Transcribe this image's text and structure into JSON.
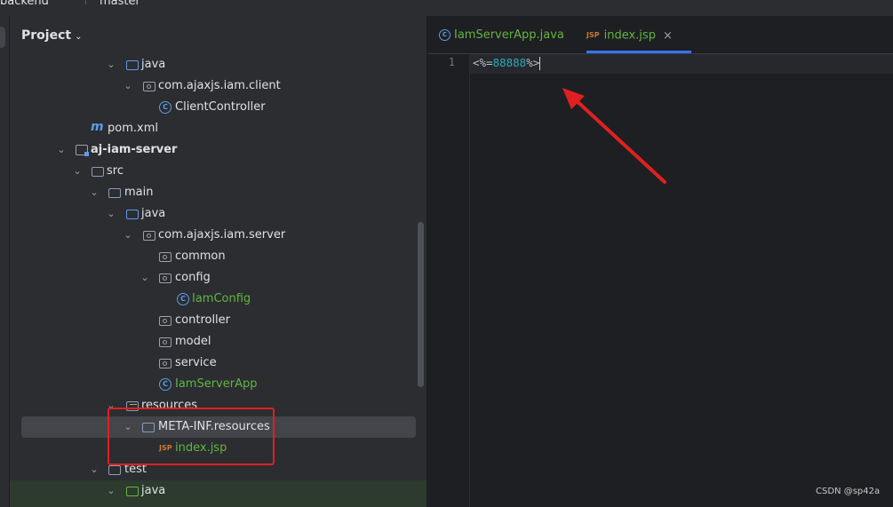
{
  "titlebar": {
    "project": "backend",
    "branch": "master"
  },
  "project_panel": {
    "header": "Project",
    "tree": [
      {
        "label": "java"
      },
      {
        "label": "com.ajaxjs.iam.client"
      },
      {
        "label": "ClientController"
      },
      {
        "label": "pom.xml"
      },
      {
        "label": "aj-iam-server"
      },
      {
        "label": "src"
      },
      {
        "label": "main"
      },
      {
        "label": "java"
      },
      {
        "label": "com.ajaxjs.iam.server"
      },
      {
        "label": "common"
      },
      {
        "label": "config"
      },
      {
        "label": "IamConfig"
      },
      {
        "label": "controller"
      },
      {
        "label": "model"
      },
      {
        "label": "service"
      },
      {
        "label": "IamServerApp"
      },
      {
        "label": "resources"
      },
      {
        "label": "META-INF.resources"
      },
      {
        "label": "index.jsp"
      },
      {
        "label": "test"
      },
      {
        "label": "java"
      }
    ]
  },
  "editor": {
    "tabs": [
      {
        "label": "IamServerApp.java",
        "icon": "class-icon"
      },
      {
        "label": "index.jsp",
        "icon": "jsp-icon",
        "close": "×"
      }
    ],
    "line_number": "1",
    "code": {
      "prefix": "<%=",
      "number": "88888",
      "suffix": "%>"
    }
  },
  "icons": {
    "jsp": "JSP",
    "class": "C",
    "maven": "m"
  },
  "watermark": "CSDN @sp42a",
  "colors": {
    "annotation": "#e02020",
    "accent": "#3574f0",
    "modified": "#62b543"
  }
}
